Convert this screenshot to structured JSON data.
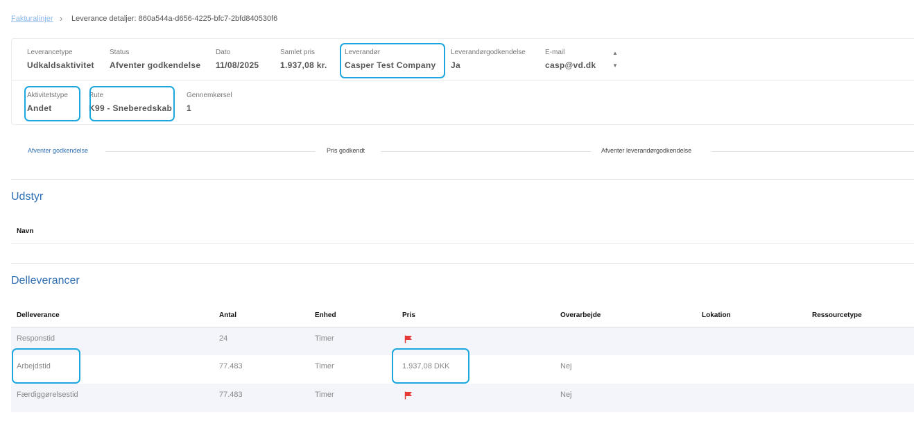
{
  "breadcrumb": {
    "link": "Fakturalinjer",
    "separator": "›",
    "current": "Leverance detaljer: 860a544a-d656-4225-bfc7-2bfd840530f6"
  },
  "details": {
    "row1": [
      {
        "label": "Leverancetype",
        "value": "Udkaldsaktivitet"
      },
      {
        "label": "Status",
        "value": "Afventer godkendelse"
      },
      {
        "label": "Dato",
        "value": "11/08/2025"
      },
      {
        "label": "Samlet pris",
        "value": "1.937,08 kr."
      },
      {
        "label": "Leverandør",
        "value": "Casper Test Company"
      },
      {
        "label": "Leverandørgodkendelse",
        "value": "Ja"
      },
      {
        "label": "E-mail",
        "value": "casp@vd.dk"
      }
    ],
    "row2": [
      {
        "label": "Aktivitetstype",
        "value": "Andet"
      },
      {
        "label": "Rute",
        "value": "K99 - Sneberedskab"
      },
      {
        "label": "Gennemkørsel",
        "value": "1"
      }
    ],
    "scroll_up": "▲",
    "scroll_down": "▼"
  },
  "stepper": {
    "steps": [
      "Afventer godkendelse",
      "Pris godkendt",
      "Afventer leverandørgodkendelse"
    ],
    "active_index": 0
  },
  "equipment": {
    "title": "Udstyr",
    "columns": [
      "Navn"
    ]
  },
  "subdeliveries": {
    "title": "Delleverancer",
    "columns": [
      "Delleverance",
      "Antal",
      "Enhed",
      "Pris",
      "Overarbejde",
      "Lokation",
      "Ressourcetype"
    ],
    "rows": [
      {
        "name": "Responstid",
        "antal": "24",
        "enhed": "Timer",
        "pris": "",
        "pris_flag": true,
        "overarbejde": "",
        "lokation": "",
        "ressourcetype": ""
      },
      {
        "name": "Arbejdstid",
        "antal": "77.483",
        "enhed": "Timer",
        "pris": "1.937,08 DKK",
        "pris_flag": false,
        "overarbejde": "Nej",
        "lokation": "",
        "ressourcetype": ""
      },
      {
        "name": "Færdiggørelsestid",
        "antal": "77.483",
        "enhed": "Timer",
        "pris": "",
        "pris_flag": true,
        "overarbejde": "Nej",
        "lokation": "",
        "ressourcetype": ""
      }
    ]
  },
  "colors": {
    "accent": "#2f6fb3",
    "highlight": "#1ea7de",
    "flag": "#e53935",
    "row_alt": "#f3f5fb"
  },
  "icons": {
    "flag": "flag-icon"
  }
}
